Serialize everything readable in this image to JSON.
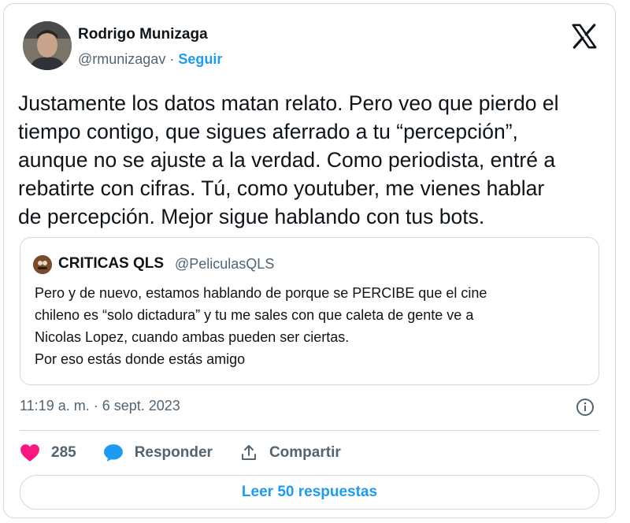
{
  "author": {
    "name": "Rodrigo Munizaga",
    "handle": "@rmunizagav",
    "separator": "·",
    "follow_label": "Seguir"
  },
  "tweet": {
    "lines": [
      "Justamente los datos matan relato. Pero veo que pierdo el",
      "tiempo contigo, que sigues aferrado a tu “percepción”,",
      "aunque no se ajuste a la verdad. Como periodista, entré a",
      "rebatirte con cifras. Tú, como youtuber, me vienes hablar",
      "de percepción. Mejor sigue hablando con tus bots."
    ]
  },
  "quote": {
    "name": "CRITICAS QLS",
    "handle": "@PeliculasQLS",
    "lines": [
      "Pero y de nuevo, estamos hablando de porque se PERCIBE que el cine",
      "chileno es “solo dictadura” y tu me sales con que caleta de gente ve a",
      "Nicolas Lopez, cuando ambas pueden ser ciertas.",
      "Por eso estás donde estás amigo"
    ]
  },
  "timestamp": "11:19 a. m. · 6 sept. 2023",
  "actions": {
    "likes": "285",
    "reply_label": "Responder",
    "share_label": "Compartir"
  },
  "read_replies_label": "Leer 50 respuestas",
  "icons": {
    "logo": "x-logo-icon",
    "info": "info-icon",
    "like": "heart-icon",
    "reply": "speech-bubble-icon",
    "share": "share-icon"
  },
  "colors": {
    "accent": "#1d9bf0",
    "heart": "#f91880",
    "muted": "#536471",
    "border": "#cfd9de"
  }
}
